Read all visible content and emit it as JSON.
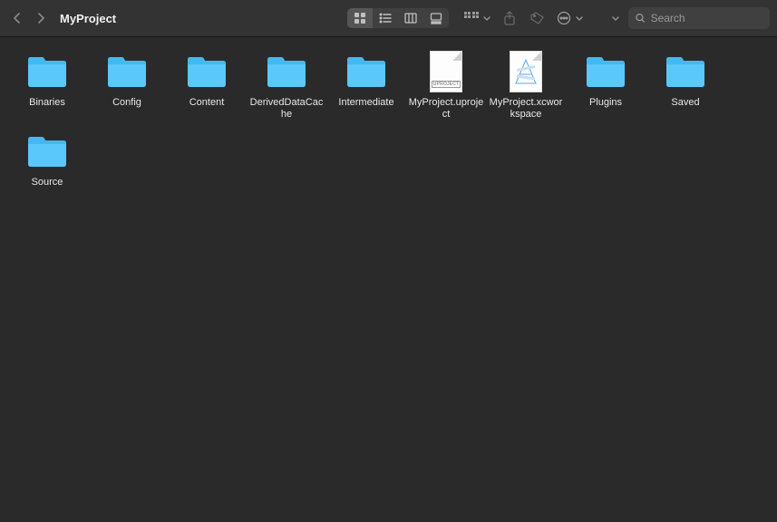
{
  "toolbar": {
    "title": "MyProject",
    "search_placeholder": "Search"
  },
  "items": [
    {
      "name": "Binaries",
      "type": "folder"
    },
    {
      "name": "Config",
      "type": "folder"
    },
    {
      "name": "Content",
      "type": "folder"
    },
    {
      "name": "DerivedDataCache",
      "type": "folder"
    },
    {
      "name": "Intermediate",
      "type": "folder"
    },
    {
      "name": "MyProject.uproject",
      "type": "uproject"
    },
    {
      "name": "MyProject.xcworkspace",
      "type": "xcworkspace"
    },
    {
      "name": "Plugins",
      "type": "folder"
    },
    {
      "name": "Saved",
      "type": "folder"
    },
    {
      "name": "Source",
      "type": "folder"
    }
  ]
}
